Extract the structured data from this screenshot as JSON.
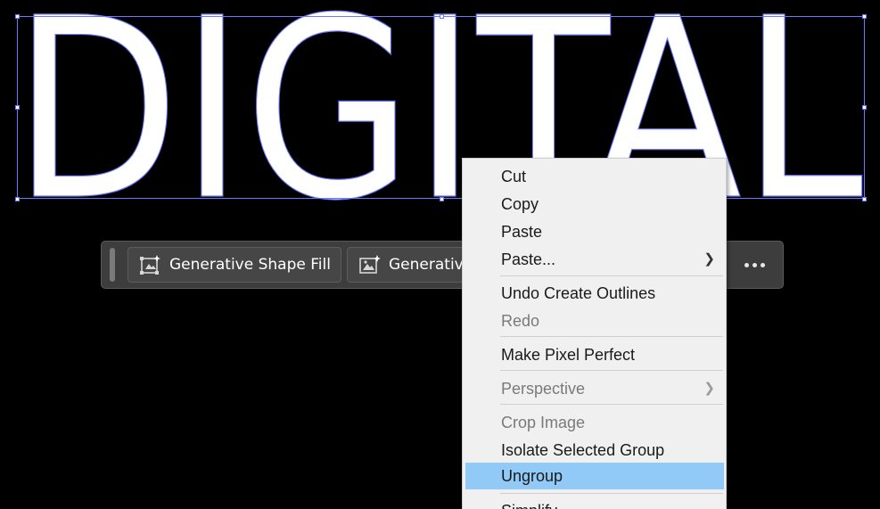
{
  "artwork": {
    "text": "DIGITAL"
  },
  "taskbar": {
    "buttons": [
      {
        "label": "Generative Shape Fill",
        "icon": "generative-shape-fill-icon"
      },
      {
        "label": "Generative",
        "icon": "generative-recolor-icon"
      }
    ],
    "more_icon": "more-options-icon"
  },
  "context_menu": {
    "items": [
      {
        "label": "Cut",
        "enabled": true
      },
      {
        "label": "Copy",
        "enabled": true
      },
      {
        "label": "Paste",
        "enabled": true
      },
      {
        "label": "Paste...",
        "enabled": true,
        "submenu": true
      },
      {
        "label": "Undo Create Outlines",
        "enabled": true
      },
      {
        "label": "Redo",
        "enabled": false
      },
      {
        "label": "Make Pixel Perfect",
        "enabled": true
      },
      {
        "label": "Perspective",
        "enabled": false,
        "submenu": true
      },
      {
        "label": "Crop Image",
        "enabled": false
      },
      {
        "label": "Isolate Selected Group",
        "enabled": true
      },
      {
        "label": "Ungroup",
        "enabled": true,
        "highlighted": true
      },
      {
        "label": "Simplify",
        "enabled": true
      }
    ]
  },
  "colors": {
    "canvas": "#000000",
    "selection": "#6a78ff",
    "menu_highlight": "#91c9f7",
    "taskbar": "#3d3d3d"
  }
}
